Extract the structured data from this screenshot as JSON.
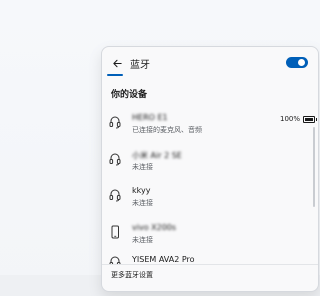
{
  "header": {
    "title": "蓝牙",
    "bluetooth_on": true,
    "accent_color": "#005fb8"
  },
  "section": {
    "label": "你的设备"
  },
  "devices": [
    {
      "name": "HERO E1",
      "status": "已连接的麦克风、音频",
      "icon": "headset-icon",
      "battery_text": "100%",
      "battery_level": 1.0,
      "blurred": true
    },
    {
      "name": "小米 Air 2 SE",
      "status": "未连接",
      "icon": "headset-icon",
      "blurred_name": true
    },
    {
      "name": "kkyy",
      "status": "未连接",
      "icon": "headset-icon"
    },
    {
      "name": "vivo X200s",
      "status": "未连接",
      "icon": "phone-icon",
      "blurred_name": true
    },
    {
      "name": "YISEM AVA2 Pro",
      "status": "",
      "icon": "headset-icon"
    }
  ],
  "footer": {
    "label": "更多蓝牙设置"
  }
}
